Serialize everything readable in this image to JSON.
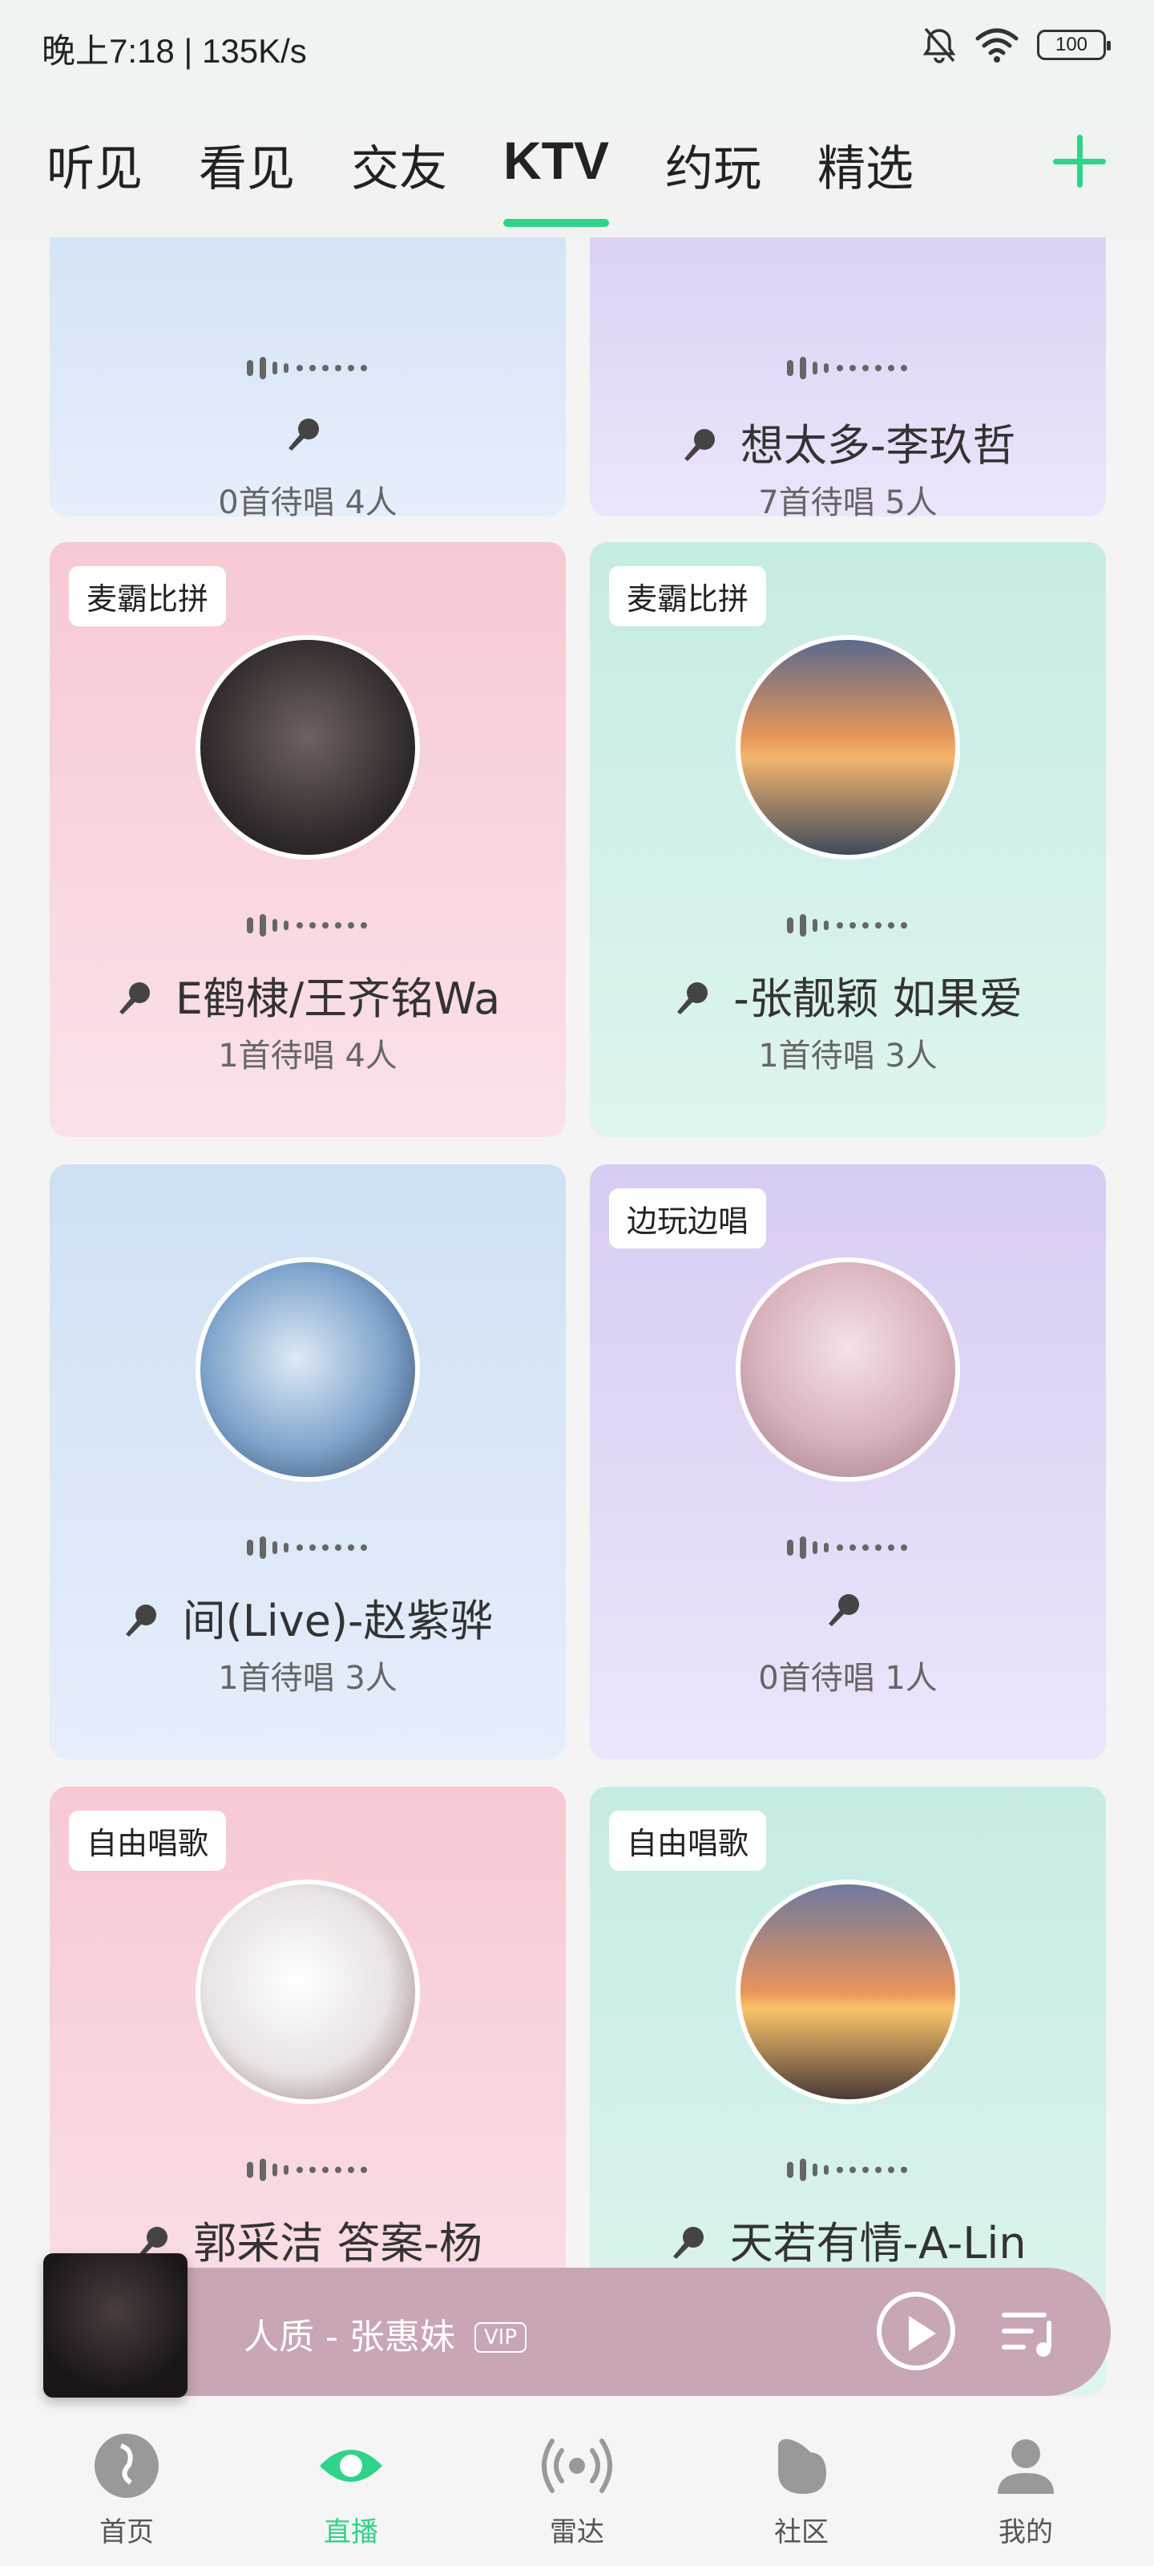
{
  "status_bar": {
    "time": "晚上7:18 | 135K/s",
    "battery": "100"
  },
  "tabs": [
    {
      "label": "听见"
    },
    {
      "label": "看见"
    },
    {
      "label": "交友"
    },
    {
      "label": "KTV",
      "active": true
    },
    {
      "label": "约玩"
    },
    {
      "label": "精选"
    }
  ],
  "cards": [
    {
      "badge": "",
      "song": "",
      "meta": "0首待唱  4人",
      "color": "blue"
    },
    {
      "badge": "",
      "song": "想太多-李玖哲",
      "meta": "7首待唱  5人",
      "color": "purple"
    },
    {
      "badge": "麦霸比拼",
      "song": "E鹤棣/王齐铭Wa",
      "meta": "1首待唱  4人",
      "color": "pink"
    },
    {
      "badge": "麦霸比拼",
      "song": "-张靓颖  如果爱",
      "meta": "1首待唱  3人",
      "color": "mint"
    },
    {
      "badge": "",
      "song": "间(Live)-赵紫骅",
      "meta": "1首待唱  3人",
      "color": "blue"
    },
    {
      "badge": "边玩边唱",
      "song": "",
      "meta": "0首待唱  1人",
      "color": "purple"
    },
    {
      "badge": "自由唱歌",
      "song": "郭采洁  答案-杨",
      "meta": "",
      "color": "pink"
    },
    {
      "badge": "自由唱歌",
      "song": "天若有情-A-Lin",
      "meta": "",
      "color": "mint"
    }
  ],
  "player": {
    "title": "人质 - 张惠妹",
    "vip": "VIP"
  },
  "bottom_nav": [
    {
      "label": "首页"
    },
    {
      "label": "直播",
      "active": true
    },
    {
      "label": "雷达"
    },
    {
      "label": "社区"
    },
    {
      "label": "我的"
    }
  ],
  "colors": {
    "accent": "#2fd38a"
  }
}
